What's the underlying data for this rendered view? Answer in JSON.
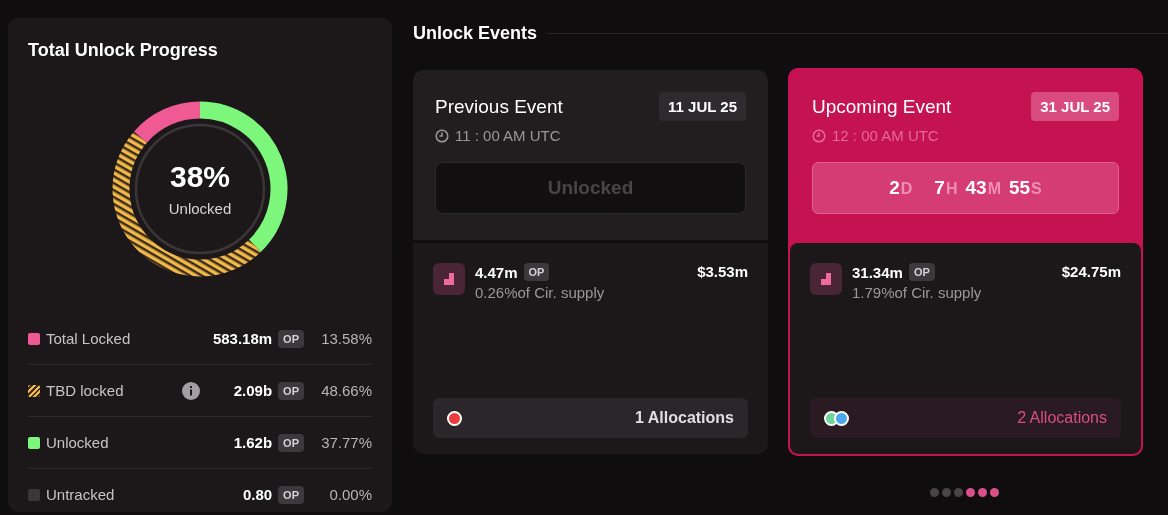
{
  "progress": {
    "title": "Total Unlock Progress",
    "center_value": "38%",
    "center_label": "Unlocked",
    "legend": [
      {
        "label": "Total Locked",
        "kind": "solid",
        "color": "#ef5a94",
        "info": false,
        "amount": "583.18m",
        "token": "OP",
        "percent": "13.58%"
      },
      {
        "label": "TBD locked",
        "kind": "hatched",
        "color": "#f2b94a",
        "info": true,
        "amount": "2.09b",
        "token": "OP",
        "percent": "48.66%"
      },
      {
        "label": "Unlocked",
        "kind": "solid",
        "color": "#7cf77c",
        "info": false,
        "amount": "1.62b",
        "token": "OP",
        "percent": "37.77%"
      },
      {
        "label": "Untracked",
        "kind": "solid",
        "color": "#3b3639",
        "info": false,
        "amount": "0.80",
        "token": "OP",
        "percent": "0.00%"
      }
    ]
  },
  "events_title": "Unlock Events",
  "events": [
    {
      "kind": "previous",
      "highlighted": false,
      "title": "Previous Event",
      "date": "11 JUL 25",
      "time": "11 : 00 AM UTC",
      "status": "Unlocked",
      "amount": "4.47m",
      "token": "OP",
      "supply": "0.26%of Cir. supply",
      "value": "$3.53m",
      "allocations": "1 Allocations",
      "allocation_dots": [
        {
          "color": "#ef3b3b"
        }
      ]
    },
    {
      "kind": "upcoming",
      "highlighted": true,
      "title": "Upcoming Event",
      "date": "31 JUL 25",
      "time": "12 : 00 AM UTC",
      "countdown": [
        {
          "value": "2",
          "unit": "D"
        },
        {
          "value": "7",
          "unit": "H"
        },
        {
          "value": "43",
          "unit": "M"
        },
        {
          "value": "55",
          "unit": "S"
        }
      ],
      "amount": "31.34m",
      "token": "OP",
      "supply": "1.79%of Cir. supply",
      "value": "$24.75m",
      "allocations": "2 Allocations",
      "allocation_dots": [
        {
          "color": "#6fd49a"
        },
        {
          "color": "#4aa8e8"
        }
      ]
    }
  ],
  "pager": [
    {
      "selected": false
    },
    {
      "selected": false
    },
    {
      "selected": false
    },
    {
      "selected": true
    },
    {
      "selected": true
    },
    {
      "selected": true
    }
  ]
}
